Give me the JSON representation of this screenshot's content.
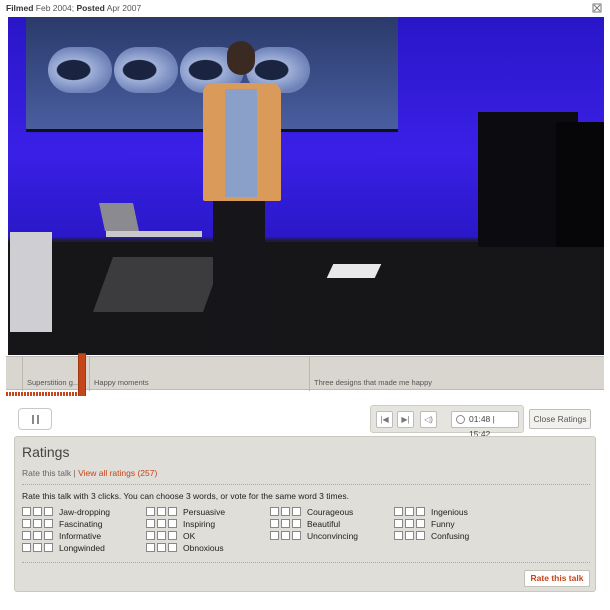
{
  "header": {
    "filmed_label": "Filmed",
    "filmed_date": "Feb 2004;",
    "posted_label": "Posted",
    "posted_date": "Apr 2007"
  },
  "chapters": [
    {
      "label": ""
    },
    {
      "label": "Superstition g..."
    },
    {
      "label": "Happy moments"
    },
    {
      "label": "Three designs that made me happy"
    }
  ],
  "playback": {
    "current_time": "01:48",
    "separator": "|",
    "total_time": "15:42",
    "progress_fraction": 0.115
  },
  "buttons": {
    "close_ratings": "Close Ratings",
    "rate_this_talk": "Rate this talk"
  },
  "ratings": {
    "title": "Ratings",
    "rate_link": "Rate this talk",
    "divider": "|",
    "view_all": "View all ratings (257)",
    "instructions": "Rate this talk with 3 clicks. You can choose 3 words, or vote for the same word 3 times.",
    "columns": [
      [
        "Jaw-dropping",
        "Fascinating",
        "Informative",
        "Longwinded"
      ],
      [
        "Persuasive",
        "Inspiring",
        "OK",
        "Obnoxious"
      ],
      [
        "Courageous",
        "Beautiful",
        "Unconvincing"
      ],
      [
        "Ingenious",
        "Funny",
        "Confusing"
      ]
    ]
  }
}
